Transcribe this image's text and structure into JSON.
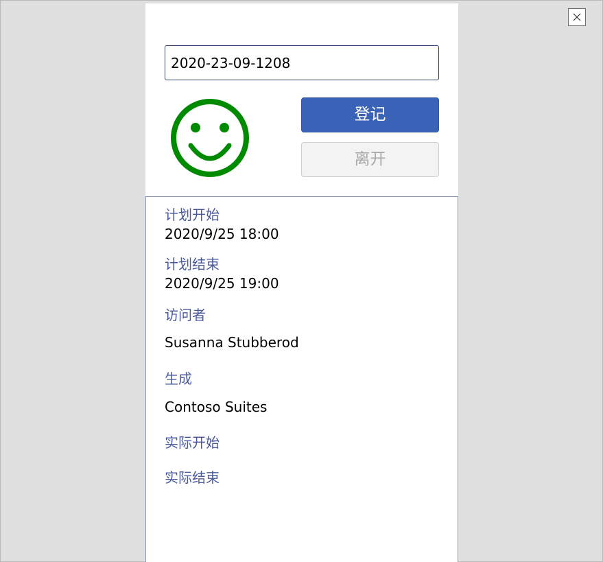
{
  "window": {
    "close_icon": "close-icon"
  },
  "visit": {
    "code_value": "2020-23-09-1208",
    "status_icon": "smiley-icon",
    "status_color": "#008a00"
  },
  "actions": {
    "checkin_label": "登记",
    "checkout_label": "离开",
    "checkin_color": "#3a62b6"
  },
  "details": {
    "planned_start_label": "计划开始",
    "planned_start_value": "2020/9/25 18:00",
    "planned_end_label": "计划结束",
    "planned_end_value": "2020/9/25 19:00",
    "visitor_label": "访问者",
    "visitor_value": "Susanna Stubberod",
    "building_label": "生成",
    "building_value": "Contoso Suites",
    "actual_start_label": "实际开始",
    "actual_end_label": "实际结束"
  },
  "colors": {
    "label_color": "#4a5a9c",
    "background": "#dfdfdf"
  }
}
